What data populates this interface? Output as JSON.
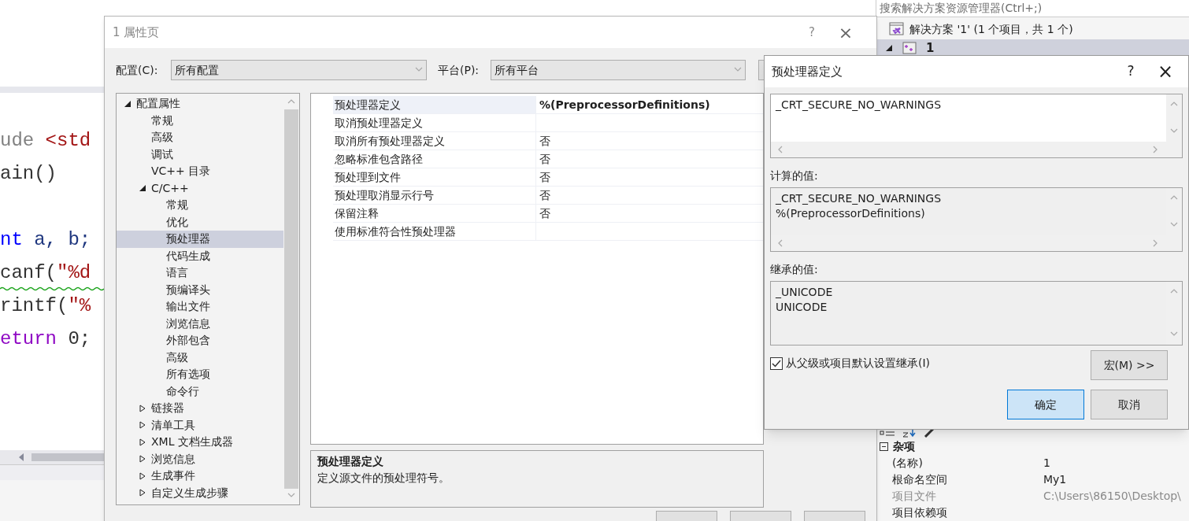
{
  "editor": {
    "code_lines": [
      {
        "warning": false,
        "tokens": [
          {
            "text": "ude ",
            "kind": "directive"
          },
          {
            "text": "<std",
            "kind": "string"
          }
        ]
      },
      {
        "warning": false,
        "tokens": [
          {
            "text": "ain()",
            "kind": "plain"
          }
        ]
      },
      {
        "kind": "blank",
        "warning": false
      },
      {
        "warning": false,
        "tokens": [
          {
            "text": "nt",
            "kind": "keyword"
          },
          {
            "text": " a, b;",
            "kind": "ident"
          }
        ]
      },
      {
        "warning": true,
        "tokens": [
          {
            "text": "canf(",
            "kind": "plain"
          },
          {
            "text": "\"%d",
            "kind": "string"
          }
        ]
      },
      {
        "warning": false,
        "tokens": [
          {
            "text": "rintf(",
            "kind": "plain"
          },
          {
            "text": "\"%",
            "kind": "string"
          }
        ]
      },
      {
        "warning": false,
        "tokens": [
          {
            "text": "eturn",
            "kind": "control"
          },
          {
            "text": " 0;",
            "kind": "plain"
          }
        ]
      }
    ]
  },
  "solution_explorer": {
    "search": {
      "placeholder": "搜索解决方案资源管理器(Ctrl+;)"
    },
    "solution": "解决方案 '1' (1 个项目，共 1 个)",
    "project": {
      "name": "1",
      "expanded": true
    }
  },
  "properties_panel": {
    "category": {
      "name": "杂项",
      "expanded": true
    },
    "rows": [
      {
        "name": "(名称)",
        "value": "1",
        "disabled": false
      },
      {
        "name": "根命名空间",
        "value": "My1",
        "disabled": false
      },
      {
        "name": "项目文件",
        "value": "C:\\Users\\86150\\Desktop\\",
        "disabled": true
      },
      {
        "name": "项目依赖项",
        "disabled": false
      }
    ]
  },
  "property_pages": {
    "title": "1 属性页",
    "help": "?",
    "close": "×",
    "configuration": {
      "label": "配置(C):",
      "value": "所有配置"
    },
    "platform": {
      "label": "平台(P):",
      "value": "所有平台"
    },
    "tree": [
      {
        "label": "配置属性",
        "expanded": true,
        "selected": false,
        "children": [
          {
            "label": "常规",
            "selected": false
          },
          {
            "label": "高级",
            "selected": false
          },
          {
            "label": "调试",
            "selected": false
          },
          {
            "label": "VC++ 目录",
            "selected": false
          },
          {
            "label": "C/C++",
            "expanded": true,
            "selected": false,
            "children": [
              {
                "label": "常规",
                "selected": false
              },
              {
                "label": "优化",
                "selected": false
              },
              {
                "label": "预处理器",
                "selected": true
              },
              {
                "label": "代码生成",
                "selected": false
              },
              {
                "label": "语言",
                "selected": false
              },
              {
                "label": "预编译头",
                "selected": false
              },
              {
                "label": "输出文件",
                "selected": false
              },
              {
                "label": "浏览信息",
                "selected": false
              },
              {
                "label": "外部包含",
                "selected": false
              },
              {
                "label": "高级",
                "selected": false
              },
              {
                "label": "所有选项",
                "selected": false
              },
              {
                "label": "命令行",
                "selected": false
              }
            ]
          },
          {
            "label": "链接器",
            "expanded": false,
            "selected": false
          },
          {
            "label": "清单工具",
            "expanded": false,
            "selected": false
          },
          {
            "label": "XML 文档生成器",
            "expanded": false,
            "selected": false
          },
          {
            "label": "浏览信息",
            "expanded": false,
            "selected": false
          },
          {
            "label": "生成事件",
            "expanded": false,
            "selected": false
          },
          {
            "label": "自定义生成步骤",
            "expanded": false,
            "selected": false
          }
        ]
      }
    ],
    "properties": [
      {
        "name": "预处理器定义",
        "value": "%(PreprocessorDefinitions)",
        "selected": true
      },
      {
        "name": "取消预处理器定义",
        "selected": false
      },
      {
        "name": "取消所有预处理器定义",
        "value": "否",
        "selected": false
      },
      {
        "name": "忽略标准包含路径",
        "value": "否",
        "selected": false
      },
      {
        "name": "预处理到文件",
        "value": "否",
        "selected": false
      },
      {
        "name": "预处理取消显示行号",
        "value": "否",
        "selected": false
      },
      {
        "name": "保留注释",
        "value": "否",
        "selected": false
      },
      {
        "name": "使用标准符合性预处理器",
        "selected": false
      }
    ],
    "description": {
      "title": "预处理器定义",
      "text": "定义源文件的预处理符号。"
    }
  },
  "definitions_dialog": {
    "title": "预处理器定义",
    "help": "?",
    "close": "×",
    "edit_lines": [
      "_CRT_SECURE_NO_WARNINGS"
    ],
    "evaluated_label": "计算的值:",
    "evaluated_lines": [
      "_CRT_SECURE_NO_WARNINGS",
      "%(PreprocessorDefinitions)"
    ],
    "inherited_label": "继承的值:",
    "inherited_lines": [
      "_UNICODE",
      "UNICODE"
    ],
    "inherit": {
      "label": "从父级或项目默认设置继承(I)",
      "checked": true
    },
    "macros_button": "宏(M) >>",
    "buttons": [
      {
        "label": "确定",
        "selected": true
      },
      {
        "label": "取消",
        "selected": false
      }
    ]
  }
}
